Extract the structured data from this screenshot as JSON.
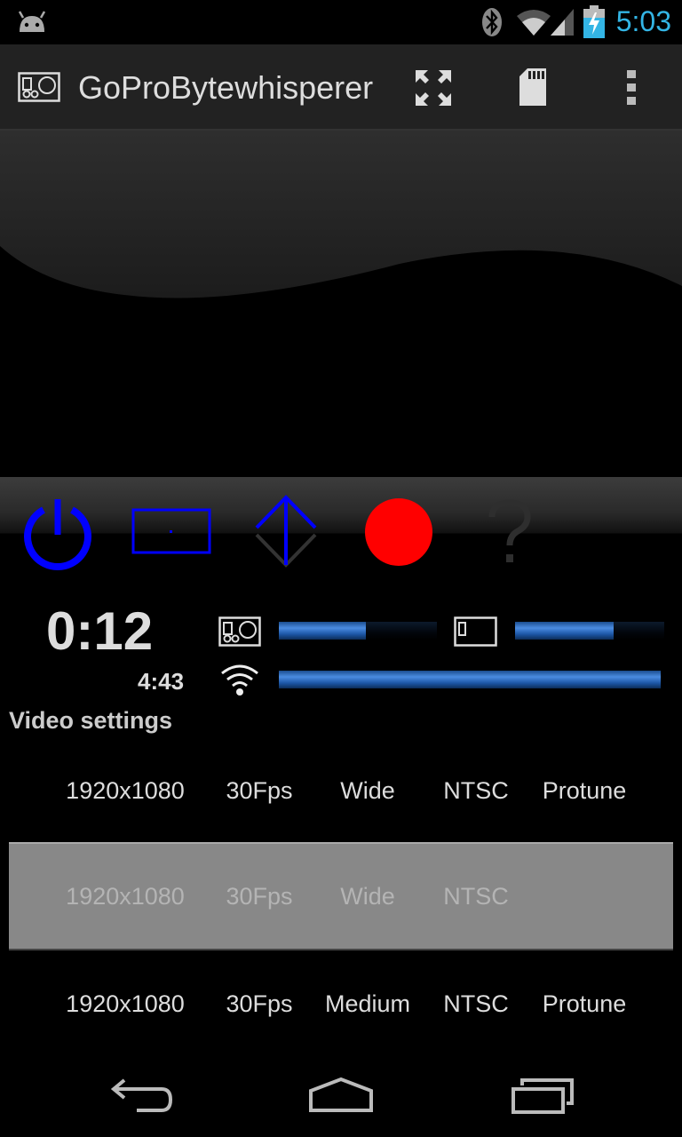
{
  "status_bar": {
    "time": "5:03",
    "icons": [
      "android-icon",
      "bluetooth-icon",
      "wifi-icon",
      "signal-icon",
      "battery-charging-icon"
    ],
    "accent_color": "#33b5e5"
  },
  "action_bar": {
    "title": "GoProBytewhisperer",
    "actions": [
      "fullscreen-icon",
      "sd-card-icon",
      "overflow-menu-icon"
    ]
  },
  "controls": {
    "buttons": [
      "power-icon",
      "mode-icon",
      "up-down-icon",
      "record-icon",
      "help-icon"
    ],
    "power_color": "#0000ff",
    "record_color": "#ff0000"
  },
  "status": {
    "elapsed": "0:12",
    "remaining": "4:43",
    "camera_battery_fraction": 0.55,
    "remote_battery_fraction": 0.66,
    "wifi_signal_fraction": 1.0
  },
  "video_settings": {
    "title": "Video settings",
    "rows": [
      {
        "resolution": "1920x1080",
        "fps": "30Fps",
        "fov": "Wide",
        "format": "NTSC",
        "protune": "Protune",
        "selected": false
      },
      {
        "resolution": "1920x1080",
        "fps": "30Fps",
        "fov": "Wide",
        "format": "NTSC",
        "protune": "",
        "selected": true
      },
      {
        "resolution": "1920x1080",
        "fps": "30Fps",
        "fov": "Medium",
        "format": "NTSC",
        "protune": "Protune",
        "selected": false
      }
    ]
  },
  "nav_bar": {
    "buttons": [
      "back-icon",
      "home-icon",
      "recent-apps-icon"
    ]
  }
}
